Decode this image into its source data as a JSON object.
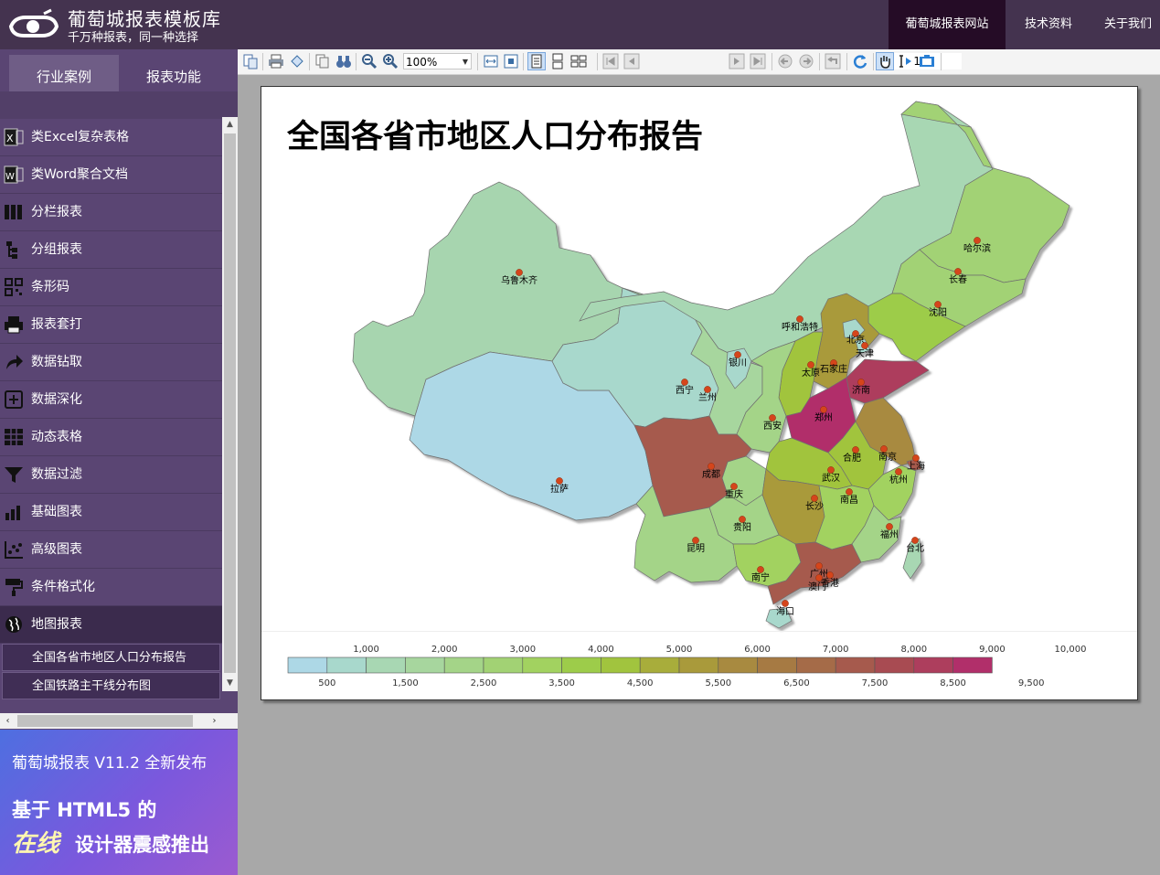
{
  "header": {
    "brand_title": "葡萄城报表模板库",
    "brand_subtitle": "千万种报表，同一种选择",
    "nav": [
      "葡萄城报表网站",
      "技术资料",
      "关于我们"
    ]
  },
  "sidebar": {
    "tabs": [
      "行业案例",
      "报表功能"
    ],
    "selected_tab": "报表功能",
    "items": [
      {
        "label": "类Excel复杂表格",
        "icon": "excel-icon"
      },
      {
        "label": "类Word聚合文档",
        "icon": "word-icon"
      },
      {
        "label": "分栏报表",
        "icon": "columns-icon"
      },
      {
        "label": "分组报表",
        "icon": "group-tree-icon"
      },
      {
        "label": "条形码",
        "icon": "qrcode-icon"
      },
      {
        "label": "报表套打",
        "icon": "printer-icon"
      },
      {
        "label": "数据钻取",
        "icon": "drill-arrow-icon"
      },
      {
        "label": "数据深化",
        "icon": "expand-plus-icon"
      },
      {
        "label": "动态表格",
        "icon": "table-grid-icon"
      },
      {
        "label": "数据过滤",
        "icon": "filter-icon"
      },
      {
        "label": "基础图表",
        "icon": "bar-chart-icon"
      },
      {
        "label": "高级图表",
        "icon": "scatter-chart-icon"
      },
      {
        "label": "条件格式化",
        "icon": "format-brush-icon"
      },
      {
        "label": "地图报表",
        "icon": "globe-icon"
      }
    ],
    "active_item": "地图报表",
    "sub_items": [
      "全国各省市地区人口分布报告",
      "全国铁路主干线分布图"
    ],
    "ad": {
      "line1": "葡萄城报表 V11.2 全新发布",
      "line2": "基于 HTML5 的",
      "line3a": "在线",
      "line3b": "设计器震感推出"
    }
  },
  "toolbar": {
    "zoom": "100%",
    "page": "1/1"
  },
  "report": {
    "title": "全国各省市地区人口分布报告",
    "cities": [
      "乌鲁木齐",
      "哈尔滨",
      "长春",
      "沈阳",
      "呼和浩特",
      "北京",
      "天津",
      "银川",
      "太原",
      "石家庄",
      "西宁",
      "兰州",
      "济南",
      "郑州",
      "西安",
      "合肥",
      "南京",
      "上海",
      "拉萨",
      "成都",
      "武汉",
      "杭州",
      "重庆",
      "长沙",
      "南昌",
      "贵阳",
      "福州",
      "昆明",
      "台北",
      "广州",
      "南宁",
      "香港",
      "澳门",
      "海口"
    ],
    "legend": {
      "upper_ticks": [
        "1,000",
        "2,000",
        "3,000",
        "4,000",
        "5,000",
        "6,000",
        "7,000",
        "8,000",
        "9,000",
        "10,000"
      ],
      "lower_ticks": [
        "500",
        "1,500",
        "2,500",
        "3,500",
        "4,500",
        "5,500",
        "6,500",
        "7,500",
        "8,500",
        "9,500"
      ],
      "colors": [
        "#add8e6",
        "#a8d8cc",
        "#a8d7b3",
        "#a7d69e",
        "#a4d488",
        "#a2d274",
        "#a2d260",
        "#9dcc4a",
        "#a1c43e",
        "#a8ad3b",
        "#a99a3b",
        "#a88a40",
        "#a67a43",
        "#a56b48",
        "#a65a4d",
        "#a84b52",
        "#ad3e5d",
        "#b12f6a"
      ]
    }
  }
}
